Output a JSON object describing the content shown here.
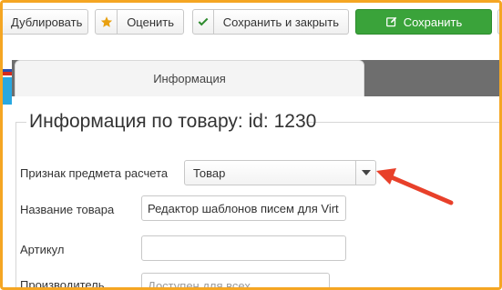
{
  "toolbar": {
    "duplicate_label": "Дублировать",
    "rate_label": "Оценить",
    "save_close_label": "Сохранить и закрыть",
    "save_label": "Сохранить"
  },
  "tabs": [
    {
      "label": "Информация",
      "active": true
    }
  ],
  "form": {
    "legend": "Информация по товару: id: 1230",
    "subject_sign": {
      "label": "Признак предмета расчета",
      "value": "Товар"
    },
    "product_name": {
      "label": "Название товара",
      "value": "Редактор шаблонов писем для Virt"
    },
    "sku": {
      "label": "Артикул",
      "value": ""
    },
    "manufacturer": {
      "label": "Производитель",
      "placeholder": "Доступен для всех"
    }
  },
  "colors": {
    "highlight_border": "#f5a623",
    "save_button": "#3aa33a",
    "annotation_arrow": "#e8402a",
    "star": "#e8a010",
    "check": "#2e8b2e"
  },
  "icons": {
    "rate": "star-icon",
    "save_close": "check-icon",
    "save": "edit-icon",
    "select": "caret-down-icon",
    "annotation": "red-arrow"
  }
}
